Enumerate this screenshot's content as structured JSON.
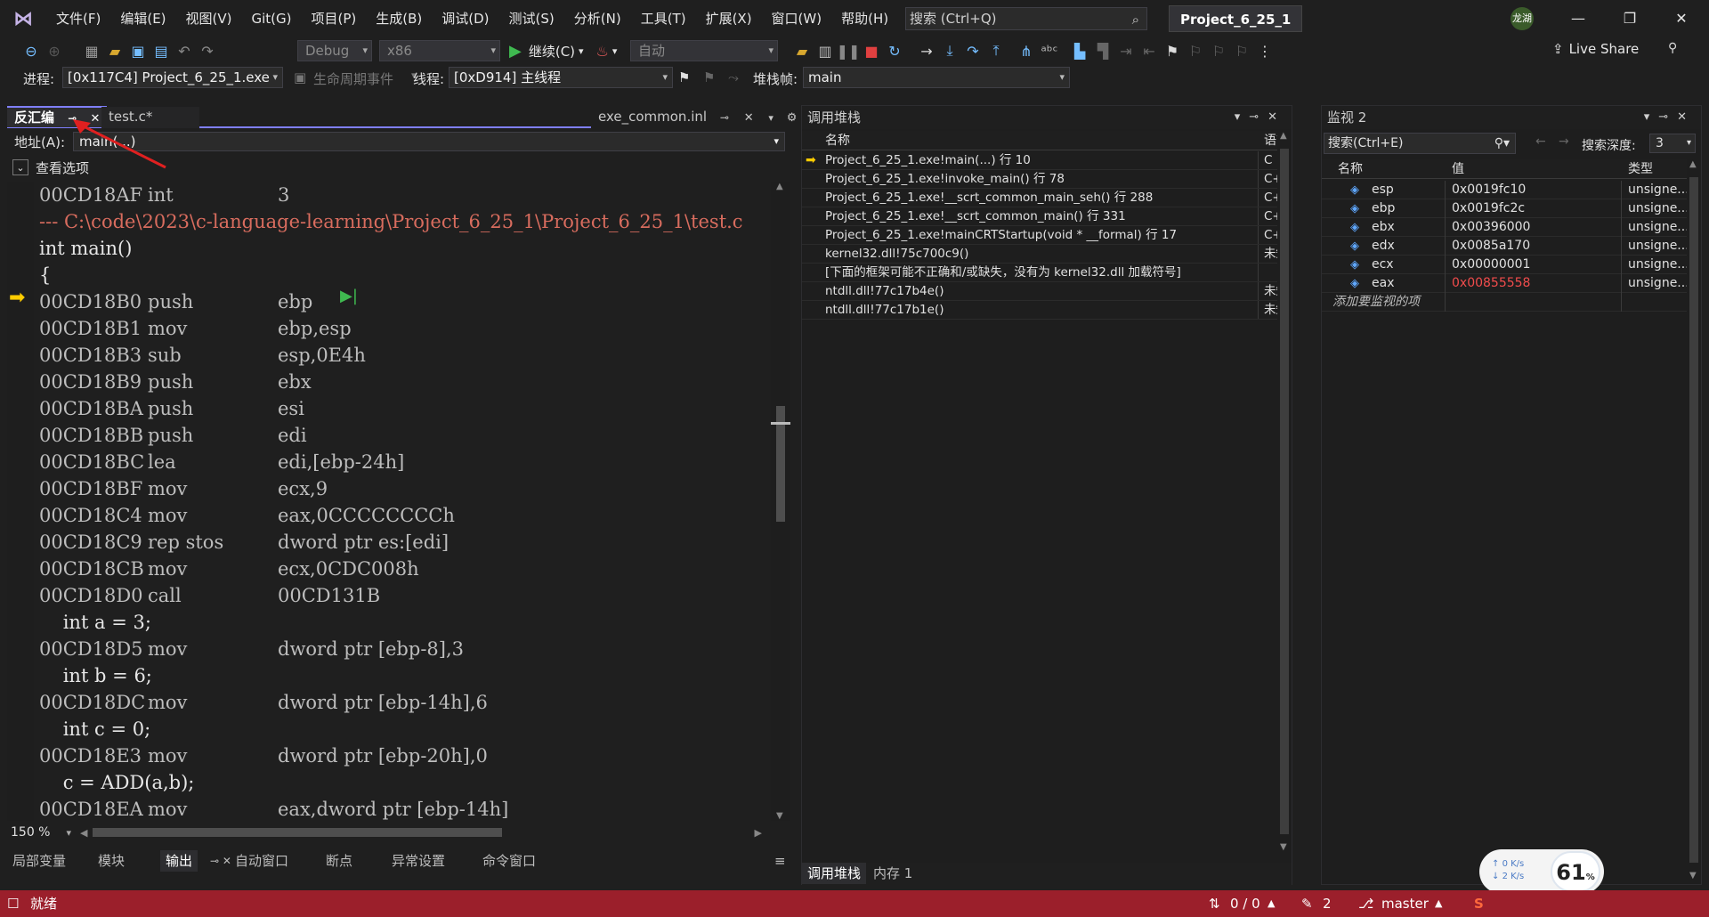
{
  "menubar": {
    "items": [
      "文件(F)",
      "编辑(E)",
      "视图(V)",
      "Git(G)",
      "项目(P)",
      "生成(B)",
      "调试(D)",
      "测试(S)",
      "分析(N)",
      "工具(T)",
      "扩展(X)",
      "窗口(W)",
      "帮助(H)"
    ],
    "search_placeholder": "搜索 (Ctrl+Q)",
    "solution_name": "Project_6_25_1",
    "user_initials": "龙湖"
  },
  "toolbar": {
    "config": "Debug",
    "platform": "x86",
    "continue_label": "继续(C)",
    "auto_label": "自动",
    "live_share": "Live Share"
  },
  "debugbar": {
    "process_label": "进程:",
    "process_value": "[0x117C4] Project_6_25_1.exe",
    "lifecycle_label": "生命周期事件",
    "thread_label": "线程:",
    "thread_value": "[0xD914] 主线程",
    "stackframe_label": "堆栈帧:",
    "stackframe_value": "main"
  },
  "editor": {
    "tabs": [
      "反汇编",
      "test.c*"
    ],
    "right_tab": "exe_common.inl",
    "address_label": "地址(A):",
    "address_value": "main(...)",
    "view_options": "查看选项",
    "zoom": "150 %",
    "lines": [
      {
        "kind": "asm",
        "addr": "00CD18AF",
        "op": "int",
        "arg": "3"
      },
      {
        "kind": "path",
        "text": "--- C:\\code\\2023\\c-language-learning\\Project_6_25_1\\Project_6_25_1\\test.c"
      },
      {
        "kind": "src",
        "text": "int main()"
      },
      {
        "kind": "src",
        "text": "{"
      },
      {
        "kind": "asm",
        "addr": "00CD18B0",
        "op": "push",
        "arg": "ebp"
      },
      {
        "kind": "asm",
        "addr": "00CD18B1",
        "op": "mov",
        "arg": "ebp,esp"
      },
      {
        "kind": "asm",
        "addr": "00CD18B3",
        "op": "sub",
        "arg": "esp,0E4h"
      },
      {
        "kind": "asm",
        "addr": "00CD18B9",
        "op": "push",
        "arg": "ebx"
      },
      {
        "kind": "asm",
        "addr": "00CD18BA",
        "op": "push",
        "arg": "esi"
      },
      {
        "kind": "asm",
        "addr": "00CD18BB",
        "op": "push",
        "arg": "edi"
      },
      {
        "kind": "asm",
        "addr": "00CD18BC",
        "op": "lea",
        "arg": "edi,[ebp-24h]"
      },
      {
        "kind": "asm",
        "addr": "00CD18BF",
        "op": "mov",
        "arg": "ecx,9"
      },
      {
        "kind": "asm",
        "addr": "00CD18C4",
        "op": "mov",
        "arg": "eax,0CCCCCCCCh"
      },
      {
        "kind": "asm",
        "addr": "00CD18C9",
        "op": "rep stos",
        "arg": "dword ptr es:[edi]"
      },
      {
        "kind": "asm",
        "addr": "00CD18CB",
        "op": "mov",
        "arg": "ecx,0CDC008h"
      },
      {
        "kind": "asm",
        "addr": "00CD18D0",
        "op": "call",
        "arg": "00CD131B"
      },
      {
        "kind": "src",
        "text": "    int a = 3;"
      },
      {
        "kind": "asm",
        "addr": "00CD18D5",
        "op": "mov",
        "arg": "dword ptr [ebp-8],3"
      },
      {
        "kind": "src",
        "text": "    int b = 6;"
      },
      {
        "kind": "asm",
        "addr": "00CD18DC",
        "op": "mov",
        "arg": "dword ptr [ebp-14h],6"
      },
      {
        "kind": "src",
        "text": "    int c = 0;"
      },
      {
        "kind": "asm",
        "addr": "00CD18E3",
        "op": "mov",
        "arg": "dword ptr [ebp-20h],0"
      },
      {
        "kind": "src",
        "text": "    c = ADD(a,b);"
      },
      {
        "kind": "asm",
        "addr": "00CD18EA",
        "op": "mov",
        "arg": "eax,dword ptr [ebp-14h]"
      }
    ]
  },
  "bottom_left_tabs": [
    "局部变量",
    "模块",
    "输出",
    "自动窗口",
    "断点",
    "异常设置",
    "命令窗口"
  ],
  "callstack": {
    "title": "调用堆栈",
    "col_name": "名称",
    "col_lang": "语言",
    "rows": [
      {
        "name": "Project_6_25_1.exe!main(...) 行 10",
        "lang": "C"
      },
      {
        "name": "Project_6_25_1.exe!invoke_main() 行 78",
        "lang": "C++"
      },
      {
        "name": "Project_6_25_1.exe!__scrt_common_main_seh() 行 288",
        "lang": "C++"
      },
      {
        "name": "Project_6_25_1.exe!__scrt_common_main() 行 331",
        "lang": "C++"
      },
      {
        "name": "Project_6_25_1.exe!mainCRTStartup(void * __formal) 行 17",
        "lang": "C++"
      },
      {
        "name": "kernel32.dll!75c700c9()",
        "lang": "未知"
      },
      {
        "name": "[下面的框架可能不正确和/或缺失，没有为 kernel32.dll 加载符号]",
        "lang": ""
      },
      {
        "name": "ntdll.dll!77c17b4e()",
        "lang": "未知"
      },
      {
        "name": "ntdll.dll!77c17b1e()",
        "lang": "未知"
      }
    ],
    "bottom_tabs": [
      "调用堆栈",
      "内存 1"
    ]
  },
  "watch": {
    "title": "监视 2",
    "search_placeholder": "搜索(Ctrl+E)",
    "depth_label": "搜索深度:",
    "depth_value": "3",
    "col_name": "名称",
    "col_value": "值",
    "col_type": "类型",
    "rows": [
      {
        "name": "esp",
        "value": "0x0019fc10",
        "type": "unsigne...",
        "changed": false
      },
      {
        "name": "ebp",
        "value": "0x0019fc2c",
        "type": "unsigne...",
        "changed": false
      },
      {
        "name": "ebx",
        "value": "0x00396000",
        "type": "unsigne...",
        "changed": false
      },
      {
        "name": "edx",
        "value": "0x0085a170",
        "type": "unsigne...",
        "changed": false
      },
      {
        "name": "ecx",
        "value": "0x00000001",
        "type": "unsigne...",
        "changed": false
      },
      {
        "name": "eax",
        "value": "0x00855558",
        "type": "unsigne...",
        "changed": true
      }
    ],
    "add_item": "添加要监视的项"
  },
  "statusbar": {
    "ready": "就绪",
    "sync": "0 / 0",
    "edits": "2",
    "branch": "master"
  },
  "net_widget": {
    "percent": "61",
    "up": "0 K/s",
    "down": "2 K/s"
  },
  "colors": {
    "status_bar": "#9b1f2b",
    "changed_value": "#f14c4c",
    "path_text": "#d86c5e"
  }
}
